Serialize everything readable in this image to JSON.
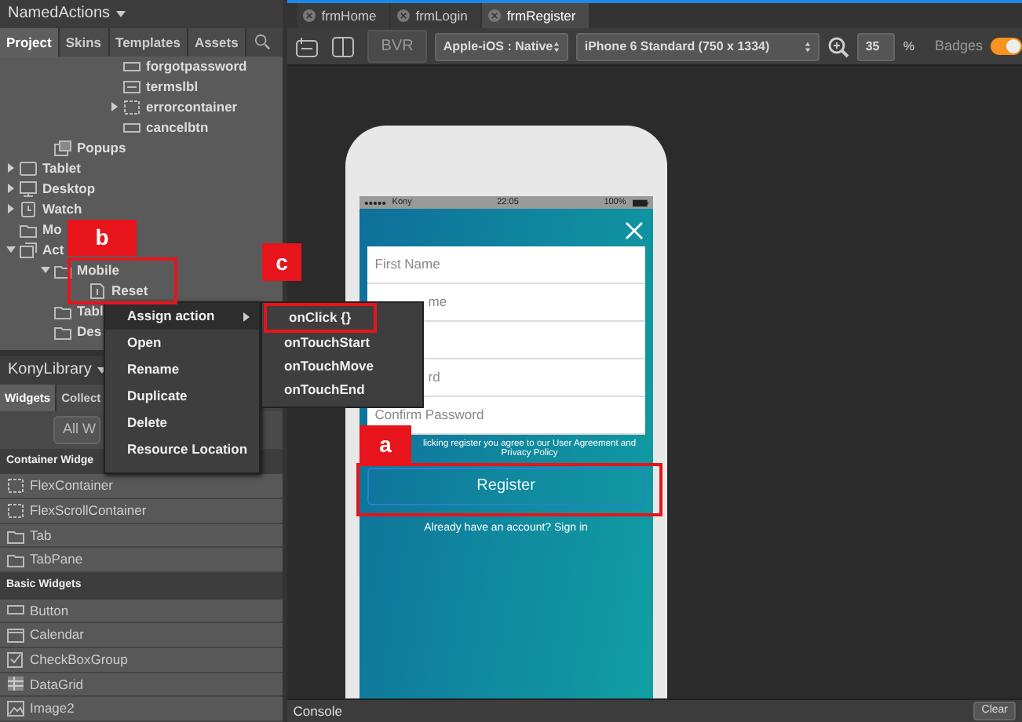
{
  "project_panel": {
    "title": "NamedActions",
    "tabs": [
      {
        "label": "Project",
        "selected": true
      },
      {
        "label": "Skins",
        "selected": false
      },
      {
        "label": "Templates",
        "selected": false
      },
      {
        "label": "Assets",
        "selected": false
      }
    ],
    "tree": [
      {
        "children": [
          {
            "children": [
              {
                "children": [
                  {
                    "label": "forgotpassword",
                    "kind": "button"
                  },
                  {
                    "label": "termslbl",
                    "kind": "label"
                  },
                  {
                    "label": "errorcontainer",
                    "kind": "container",
                    "expanded": false
                  },
                  {
                    "label": "cancelbtn",
                    "kind": "button"
                  }
                ]
              }
            ]
          },
          {
            "label": "Popups",
            "kind": "popup"
          }
        ]
      },
      {
        "label": "Tablet",
        "kind": "tablet",
        "expanded": false
      },
      {
        "label": "Desktop",
        "kind": "desktop",
        "expanded": false
      },
      {
        "label": "Watch",
        "kind": "watch",
        "expanded": false
      },
      {
        "label": "Mo",
        "kind": "folder"
      },
      {
        "label": "Act",
        "kind": "actions",
        "expanded": true,
        "children": [
          {
            "label": "Mobile",
            "kind": "folder",
            "expanded": true,
            "children": [
              {
                "label": "Reset",
                "kind": "file"
              }
            ]
          },
          {
            "label": "Tabl",
            "kind": "folder"
          },
          {
            "label": "Des",
            "kind": "folder"
          }
        ]
      }
    ]
  },
  "library_panel": {
    "title": "KonyLibrary",
    "tabs": [
      {
        "label": "Widgets",
        "selected": true
      },
      {
        "label": "Collect",
        "selected": false
      }
    ],
    "filter": "All W",
    "sections": [
      {
        "title": "Container Widge",
        "items": [
          {
            "label": "FlexContainer",
            "kind": "container"
          },
          {
            "label": "FlexScrollContainer",
            "kind": "container"
          },
          {
            "label": "Tab",
            "kind": "folder"
          },
          {
            "label": "TabPane",
            "kind": "folder"
          }
        ]
      },
      {
        "title": "Basic Widgets",
        "items": [
          {
            "label": "Button",
            "kind": "button"
          },
          {
            "label": "Calendar",
            "kind": "calendar"
          },
          {
            "label": "CheckBoxGroup",
            "kind": "check"
          },
          {
            "label": "DataGrid",
            "kind": "grid"
          },
          {
            "label": "Image2",
            "kind": "image"
          }
        ]
      }
    ]
  },
  "editor_tabs": [
    {
      "label": "frmHome",
      "selected": false
    },
    {
      "label": "frmLogin",
      "selected": false
    },
    {
      "label": "frmRegister",
      "selected": true
    }
  ],
  "toolbar": {
    "bvr": "BVR",
    "platform": "Apple-iOS : Native",
    "device": "iPhone 6 Standard (750 x 1334)",
    "zoom": "35",
    "zoom_unit": "%",
    "badges_label": "Badges",
    "badges_on": true
  },
  "phone": {
    "status_bar": {
      "carrier": "Kony",
      "time": "22:05",
      "battery": "100%"
    },
    "fields": [
      {
        "placeholder": "First Name"
      },
      {
        "placeholder": "me",
        "covered": true
      },
      {
        "placeholder": "rd",
        "covered": true
      },
      {
        "placeholder": "Confirm Password"
      }
    ],
    "agreement": "licking register you agree to our User Agreement and Privacy Policy",
    "register": "Register",
    "sign_in": "Already have an account? Sign in"
  },
  "context_menu": {
    "items": [
      {
        "label": "Assign action",
        "has_submenu": true,
        "selected": true
      },
      {
        "label": "Open",
        "has_submenu": false,
        "selected": false
      },
      {
        "label": "Rename",
        "has_submenu": false,
        "selected": false
      },
      {
        "label": "Duplicate",
        "has_submenu": false,
        "selected": false
      },
      {
        "label": "Delete",
        "has_submenu": false,
        "selected": false
      },
      {
        "label": "Resource Location",
        "has_submenu": false,
        "selected": false
      }
    ],
    "submenu": [
      "onClick {}",
      "onTouchStart",
      "onTouchMove",
      "onTouchEnd"
    ]
  },
  "annotations": [
    {
      "label": "b"
    },
    {
      "label": "c"
    },
    {
      "label": "a"
    }
  ],
  "console": {
    "title": "Console",
    "clear": "Clear"
  }
}
